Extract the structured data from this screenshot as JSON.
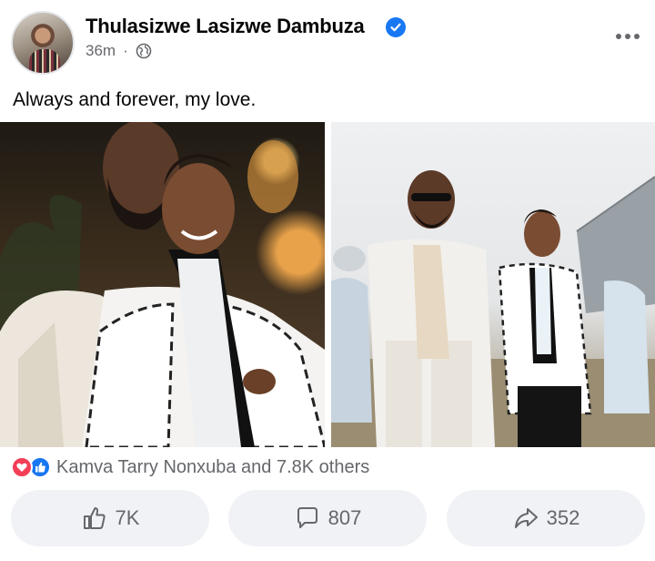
{
  "post": {
    "author": "Thulasizwe Lasizwe Dambuza",
    "time": "36m",
    "separator": "·",
    "caption": "Always and forever, my love."
  },
  "icons": {
    "verified": "verified-badge-icon",
    "audience": "globe-icon",
    "more": "more-options-icon"
  },
  "reactions": {
    "text": "Kamva Tarry Nonxuba and 7.8K others"
  },
  "actions": {
    "like_count": "7K",
    "comment_count": "807",
    "share_count": "352"
  },
  "colors": {
    "accent": "#1877f2",
    "heart": "#f33e58",
    "secondary_text": "#65676b",
    "button_bg": "#f0f2f5"
  }
}
